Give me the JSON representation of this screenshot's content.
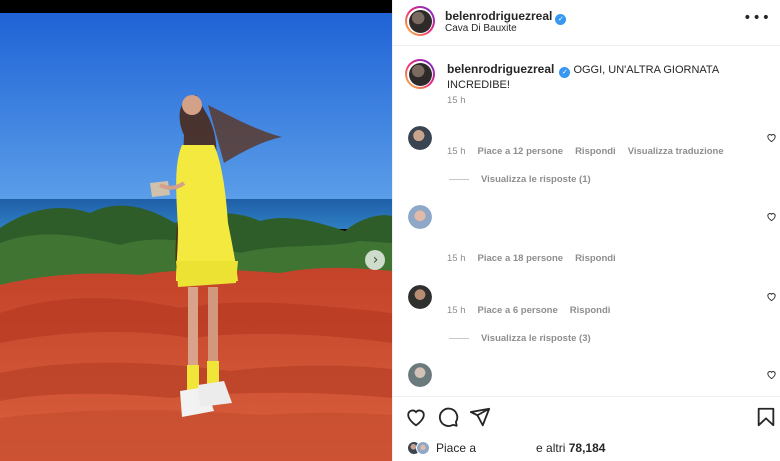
{
  "post": {
    "username": "belenrodriguezreal",
    "location": "Cava Di Bauxite",
    "caption_text": "OGGI, UN'ALTRA GIORNATA INCREDIBE!",
    "caption_time": "15 h"
  },
  "comments": [
    {
      "time": "15 h",
      "likes": "Piace a 12 persone",
      "reply": "Rispondi",
      "translate": "Visualizza traduzione",
      "view_replies": "Visualizza le risposte (1)"
    },
    {
      "time": "15 h",
      "likes": "Piace a 18 persone",
      "reply": "Rispondi"
    },
    {
      "time": "15 h",
      "likes": "Piace a 6 persone",
      "reply": "Rispondi",
      "view_replies": "Visualizza le risposte (3)"
    }
  ],
  "likes_bar": {
    "prefix": "Piace a",
    "middle": "e altri",
    "count": "78,184"
  },
  "icons": {
    "verified": "verified-badge-icon",
    "more": "more-options-icon",
    "like": "heart-icon",
    "comment": "comment-icon",
    "share": "share-icon",
    "save": "bookmark-icon",
    "next": "chevron-right-icon"
  },
  "colors": {
    "verified": "#3897f0",
    "meta_text": "#8e8e8e",
    "divider": "#efefef"
  }
}
